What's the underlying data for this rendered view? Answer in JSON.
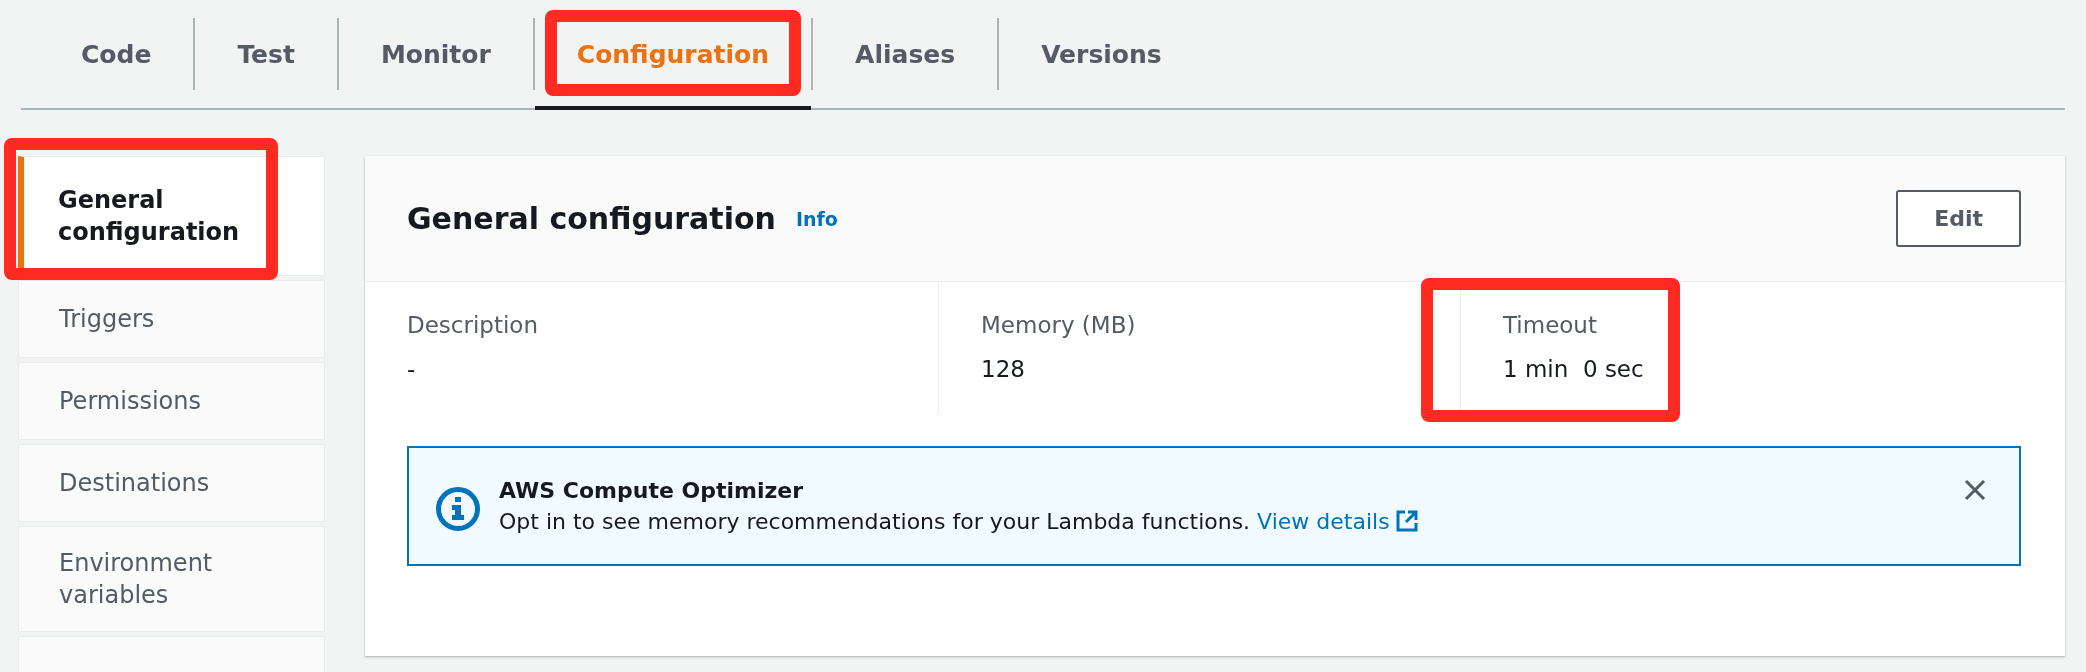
{
  "tabs": [
    {
      "label": "Code",
      "selected": false,
      "highlighted": false
    },
    {
      "label": "Test",
      "selected": false,
      "highlighted": false
    },
    {
      "label": "Monitor",
      "selected": false,
      "highlighted": false
    },
    {
      "label": "Configuration",
      "selected": true,
      "highlighted": true
    },
    {
      "label": "Aliases",
      "selected": false,
      "highlighted": false
    },
    {
      "label": "Versions",
      "selected": false,
      "highlighted": false
    }
  ],
  "sidebar": {
    "items": [
      {
        "label": "General configuration",
        "selected": true,
        "highlighted": true
      },
      {
        "label": "Triggers",
        "selected": false,
        "highlighted": false
      },
      {
        "label": "Permissions",
        "selected": false,
        "highlighted": false
      },
      {
        "label": "Destinations",
        "selected": false,
        "highlighted": false
      },
      {
        "label": "Environment variables",
        "selected": false,
        "highlighted": false
      }
    ]
  },
  "panel": {
    "title": "General configuration",
    "info_link": "Info",
    "edit_button": "Edit",
    "fields": [
      {
        "label": "Description",
        "value": "-",
        "highlighted": false
      },
      {
        "label": "Memory (MB)",
        "value": "128",
        "highlighted": false
      },
      {
        "label": "Timeout",
        "value": "1 min  0 sec",
        "highlighted": true
      }
    ],
    "alert": {
      "title": "AWS Compute Optimizer",
      "text": "Opt in to see memory recommendations for your Lambda functions.",
      "link": "View details"
    }
  }
}
